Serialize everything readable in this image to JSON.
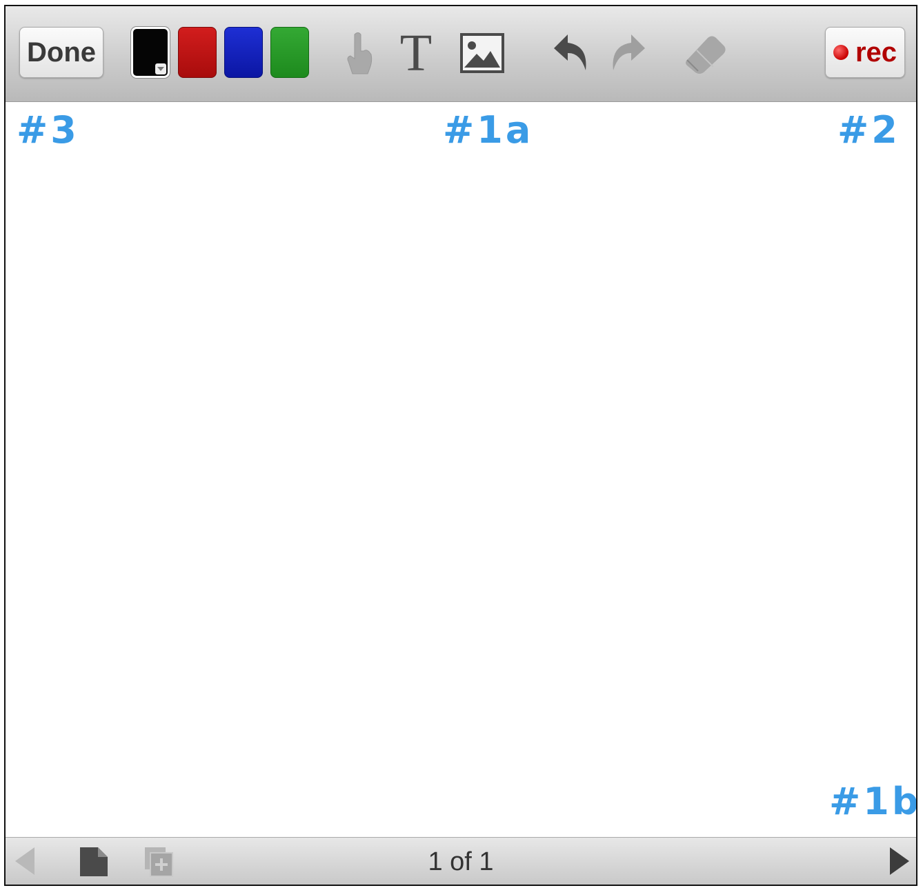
{
  "toolbar": {
    "done_label": "Done",
    "rec_label": "rec",
    "colors": [
      {
        "name": "black",
        "hex": "#050505",
        "selected": true
      },
      {
        "name": "red",
        "hex": "#c01515"
      },
      {
        "name": "blue",
        "hex": "#1522c0"
      },
      {
        "name": "green",
        "hex": "#2a9a2a"
      }
    ],
    "tools": [
      "hand-pointer-icon",
      "text-tool-icon",
      "image-icon",
      "undo-icon",
      "redo-icon",
      "eraser-icon"
    ],
    "text_tool_glyph": "T"
  },
  "annotations": {
    "label_3": "#3",
    "label_1a": "#1a",
    "label_2": "#2",
    "label_1b": "#1b",
    "color": "#3a9be6"
  },
  "bottombar": {
    "page_indicator": "1 of 1",
    "icons": [
      "previous-page-icon",
      "new-page-icon",
      "duplicate-page-icon",
      "next-page-icon"
    ]
  }
}
